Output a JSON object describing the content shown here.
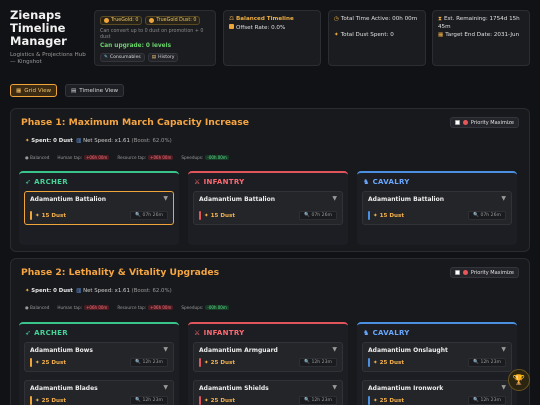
{
  "app": {
    "title": "Zienaps Timeline Manager",
    "subtitle": "Logistics & Projections Hub — Kingshot"
  },
  "currency": {
    "truegold_label": "TrueGold: 0",
    "truegold_dust_label": "TrueGold Dust: 0",
    "convert_note": "Can convert up to 0 dust on promotion + 0 dust",
    "upgrade_text": "Can upgrade: 0 levels",
    "consumables_label": "Consumables",
    "history_label": "History"
  },
  "timeline_card": {
    "line1": "Balanced Timeline",
    "line2": "Offset Rate: 0.0%"
  },
  "stats_card": {
    "total_time": "Total Time Active: 00h 00m",
    "total_dust": "Total Dust Spent: 0"
  },
  "estimate_card": {
    "remaining": "Est. Remaining: 1754d 15h 45m",
    "target": "Target End Date: 2031-Jun"
  },
  "views": {
    "grid_label": "Grid View",
    "timeline_label": "Timeline View"
  },
  "phases": [
    {
      "title": "Phase 1: Maximum March Capacity Increase",
      "priority_label": "Priority Maximize",
      "spent": "Spent: 0 Dust",
      "net_speed": "Net Speed: x1.61",
      "boost": "(Boost: 62.0%)",
      "legend": {
        "balanced": "Balanced",
        "human": "Human tap:",
        "human_badge": "+06h 00m",
        "resource": "Resource tap:",
        "resource_badge": "+06h 00m",
        "speedups": "Speedups:",
        "speedups_badge": "-00h 00m"
      },
      "columns": [
        {
          "name": "ARCHER",
          "items": [
            {
              "name": "Adamantium Battalion",
              "dust": "15 Dust",
              "time": "07h 26m"
            }
          ]
        },
        {
          "name": "INFANTRY",
          "items": [
            {
              "name": "Adamantium Battalion",
              "dust": "15 Dust",
              "time": "07h 26m"
            }
          ]
        },
        {
          "name": "CAVALRY",
          "items": [
            {
              "name": "Adamantium Battalion",
              "dust": "15 Dust",
              "time": "07h 26m"
            }
          ]
        }
      ]
    },
    {
      "title": "Phase 2: Lethality & Vitality Upgrades",
      "priority_label": "Priority Maximize",
      "spent": "Spent: 0 Dust",
      "net_speed": "Net Speed: x1.61",
      "boost": "(Boost: 62.0%)",
      "legend": {
        "balanced": "Balanced",
        "human": "Human tap:",
        "human_badge": "+06h 00m",
        "resource": "Resource tap:",
        "resource_badge": "+06h 00m",
        "speedups": "Speedups:",
        "speedups_badge": "-00h 00m"
      },
      "columns": [
        {
          "name": "ARCHER",
          "items": [
            {
              "name": "Adamantium Bows",
              "dust": "25 Dust",
              "time": "12h 23m"
            },
            {
              "name": "Adamantium Blades",
              "dust": "25 Dust",
              "time": "12h 23m"
            }
          ]
        },
        {
          "name": "INFANTRY",
          "items": [
            {
              "name": "Adamantium Armguard",
              "dust": "25 Dust",
              "time": "12h 23m"
            },
            {
              "name": "Adamantium Shields",
              "dust": "25 Dust",
              "time": "12h 23m"
            }
          ]
        },
        {
          "name": "CAVALRY",
          "items": [
            {
              "name": "Adamantium Onslaught",
              "dust": "25 Dust",
              "time": "12h 23m"
            },
            {
              "name": "Adamantium Ironwork",
              "dust": "25 Dust",
              "time": "12h 23m"
            }
          ]
        }
      ]
    }
  ],
  "icons": {
    "archer": "bow-icon",
    "infantry": "crossed-swords-icon",
    "cavalry": "horse-icon",
    "trophy": "trophy-icon"
  }
}
